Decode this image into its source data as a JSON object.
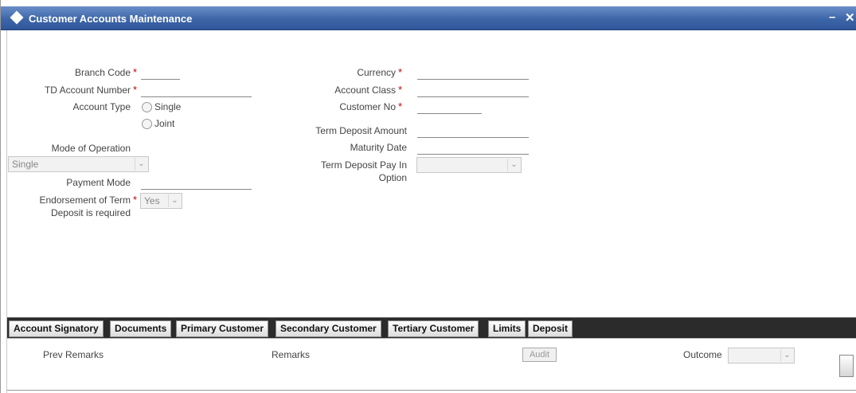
{
  "window": {
    "title": "Customer Accounts Maintenance",
    "minimize_glyph": "–",
    "close_glyph": "✕"
  },
  "form": {
    "branch_code_label": "Branch Code",
    "td_account_number_label": "TD Account Number",
    "account_type_label": "Account Type",
    "account_type_options": [
      "Single",
      "Joint"
    ],
    "mode_of_operation_label": "Mode of Operation",
    "mode_of_operation_value": "Single",
    "payment_mode_label": "Payment Mode",
    "endorsement_label_line1": "Endorsement of Term",
    "endorsement_label_line2": "Deposit is required",
    "endorsement_value": "Yes",
    "currency_label": "Currency",
    "account_class_label": "Account Class",
    "customer_no_label": "Customer No",
    "term_deposit_amount_label": "Term Deposit Amount",
    "maturity_date_label": "Maturity Date",
    "term_deposit_pay_in_label_line1": "Term Deposit Pay In",
    "term_deposit_pay_in_label_line2": "Option",
    "required_marker": "*"
  },
  "tabs": [
    "Account Signatory",
    "Documents",
    "Primary Customer",
    "Secondary Customer",
    "Tertiary Customer",
    "Limits",
    "Deposit"
  ],
  "footer": {
    "prev_remarks_label": "Prev Remarks",
    "remarks_label": "Remarks",
    "audit_label": "Audit",
    "outcome_label": "Outcome"
  },
  "colors": {
    "title_bar": "#3d66a8",
    "required": "#cc0000",
    "tab_bar": "#2b2b2b"
  }
}
